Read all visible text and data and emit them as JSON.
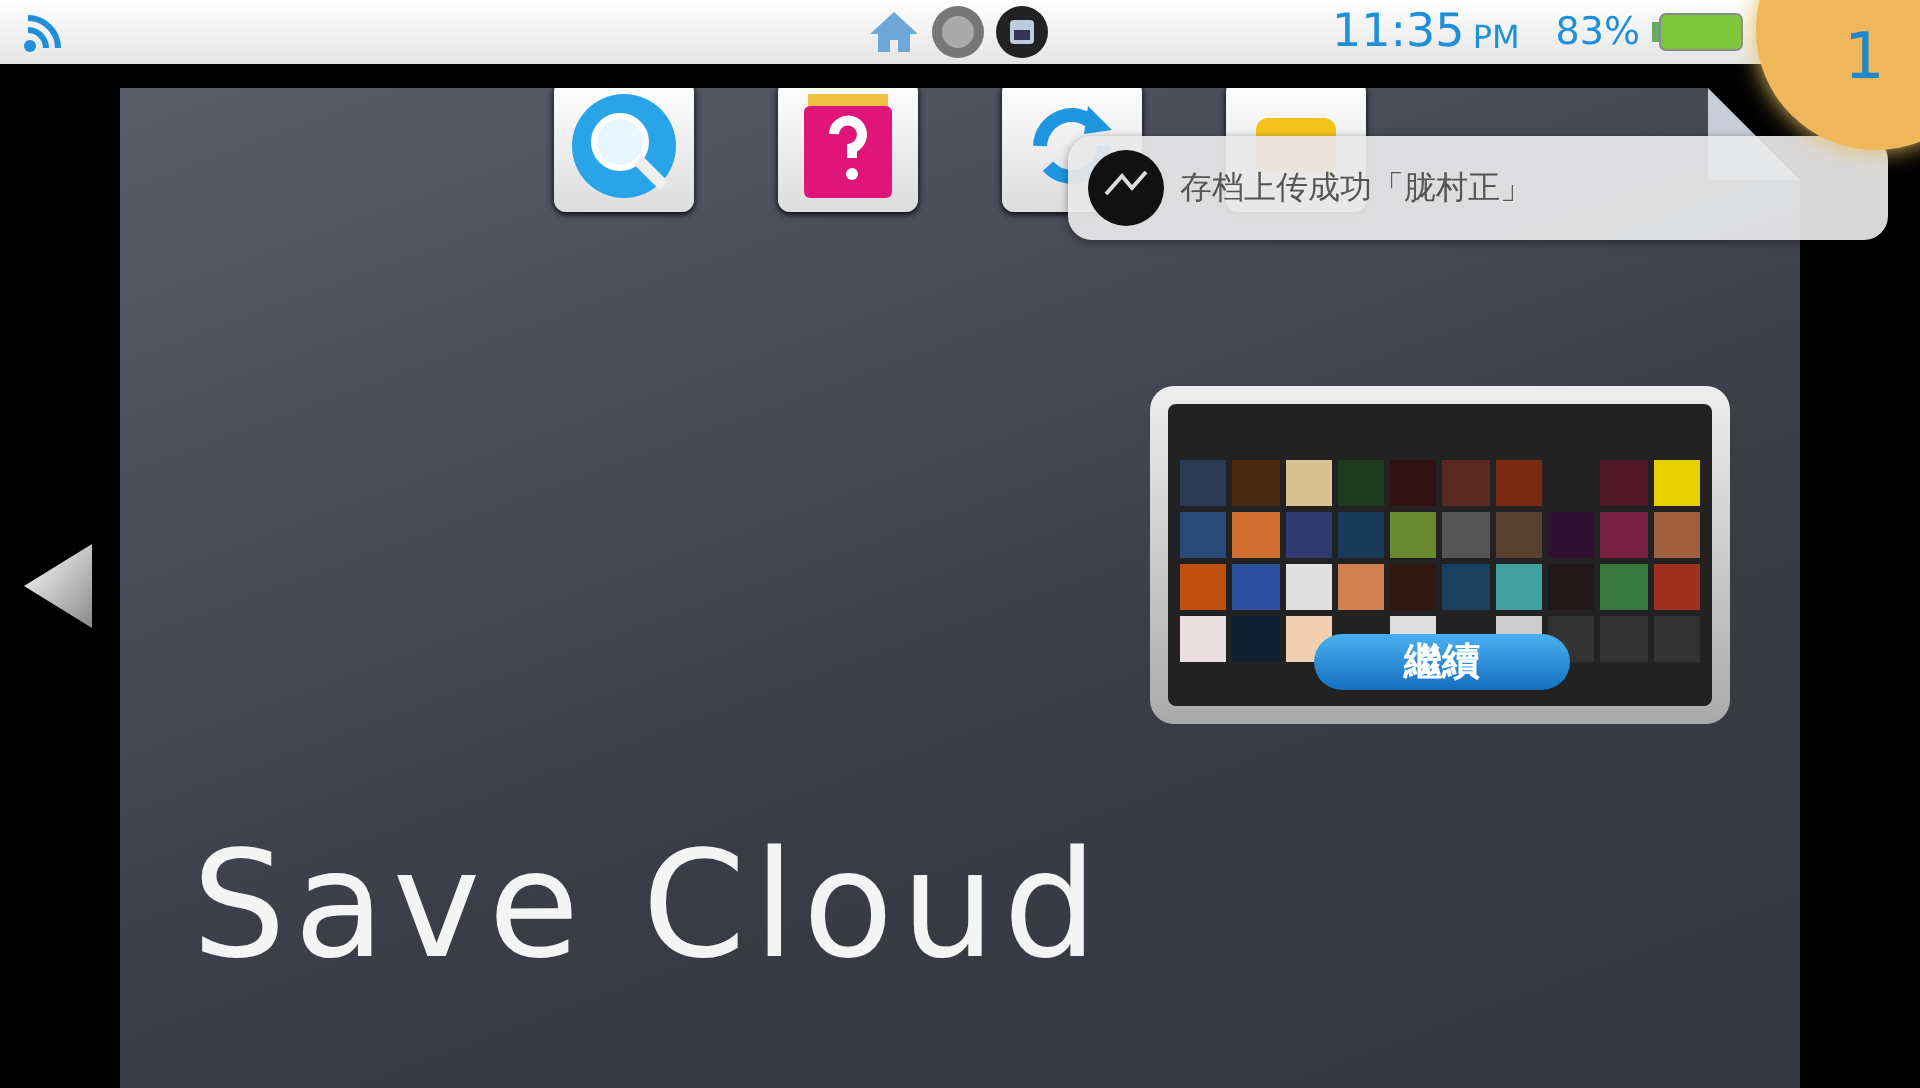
{
  "status_bar": {
    "time": "11:35",
    "meridiem": "PM",
    "battery": "83%"
  },
  "notification_badge": {
    "count": "1"
  },
  "apps": [
    {
      "kind": "browser"
    },
    {
      "kind": "help"
    },
    {
      "kind": "sync"
    },
    {
      "kind": "plus"
    }
  ],
  "notification": {
    "message": "存档上传成功「胧村正」"
  },
  "preview_card": {
    "button": "繼續"
  },
  "title": "Save Cloud"
}
